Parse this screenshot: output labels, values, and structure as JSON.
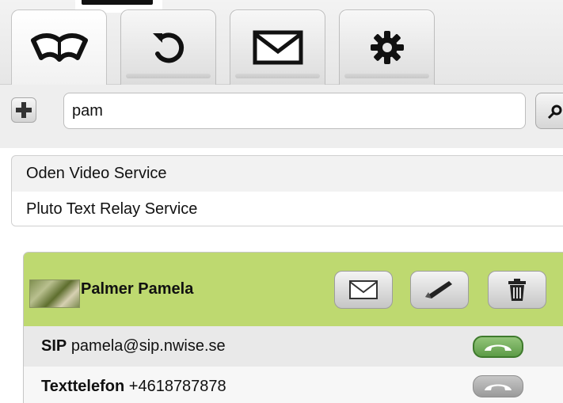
{
  "tabs": [
    {
      "icon": "book-icon"
    },
    {
      "icon": "history-icon"
    },
    {
      "icon": "envelope-icon"
    },
    {
      "icon": "gear-icon"
    }
  ],
  "search": {
    "value": "pam",
    "add_icon": "plus-icon",
    "search_icon": "magnifier-icon"
  },
  "results": [
    {
      "label": "Oden Video Service"
    },
    {
      "label": "Pluto Text Relay Service"
    }
  ],
  "contact": {
    "name": "Palmer Pamela",
    "actions": [
      "envelope-icon",
      "pencil-icon",
      "trash-icon"
    ],
    "numbers": [
      {
        "type": "SIP",
        "value": "pamela@sip.nwise.se",
        "call_state": "active"
      },
      {
        "type": "Texttelefon",
        "value": "+4618787878",
        "call_state": "inactive"
      }
    ]
  },
  "colors": {
    "contact_header": "#bed970",
    "call_active": "#5d9b47",
    "call_inactive": "#9a9a9a"
  }
}
